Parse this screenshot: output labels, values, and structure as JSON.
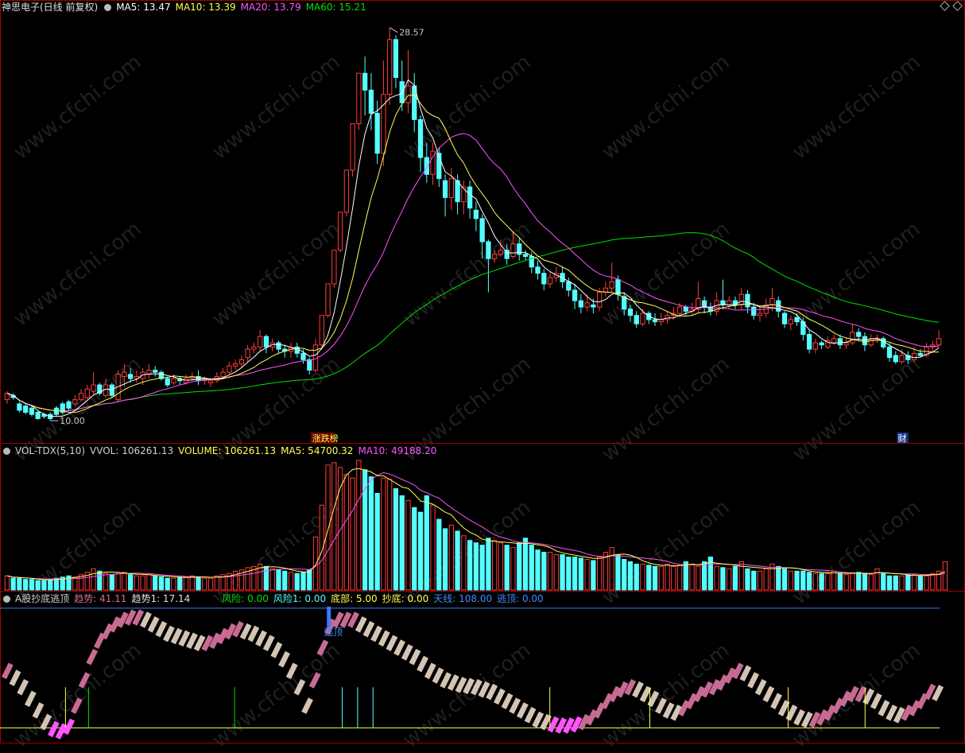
{
  "main_header": {
    "title": "神思电子(日线 前复权)",
    "ma5": "MA5: 13.47",
    "ma10": "MA10: 13.39",
    "ma20": "MA20: 13.79",
    "ma60": "MA60: 15.21",
    "high_label": "28.57",
    "low_label": "10.00",
    "marker_zdb": "涨跌榜",
    "marker_cai": "财"
  },
  "volume_header": {
    "name": "VOL-TDX(5,10)",
    "vvol": "VVOL: 106261.13",
    "volume": "VOLUME: 106261.13",
    "ma5": "MA5: 54700.32",
    "ma10": "MA10: 49188.20"
  },
  "indicator_header": {
    "name": "A股抄底逃顶",
    "trend": "趋势: 41.11",
    "trend1": "趋势1: 17.14",
    "risk": "风险: 0.00",
    "risk1": "风险1: 0.00",
    "bottom": "底部: 5.00",
    "buy_bottom": "抄底: 0.00",
    "sky_line": "天线: 108.00",
    "escape_top": "逃顶: 0.00",
    "escape_label": "逃顶"
  },
  "watermark": "www.cfchi.com",
  "colors": {
    "up": "#ff3c3c",
    "down": "#54ffff",
    "ma5": "#ffffff",
    "ma10": "#ffff54",
    "ma20": "#ff54ff",
    "ma60": "#00e000",
    "skyline": "#3c78ff",
    "baseline": "#ffff54",
    "trend_rise": "#c86a94",
    "trend_fall": "#d4c4b4",
    "risk": "#ff54ff"
  },
  "chart_data": {
    "type": "candlestick",
    "price_range": [
      10.0,
      28.57
    ],
    "high_point": 28.57,
    "low_point": 10.0,
    "ma_last": {
      "ma5": 13.47,
      "ma10": 13.39,
      "ma20": 13.79,
      "ma60": 15.21
    },
    "candles": [
      [
        10.9,
        11.2,
        10.7,
        11.3
      ],
      [
        11.1,
        11.0,
        10.9,
        11.2
      ],
      [
        10.7,
        10.4,
        10.3,
        10.8
      ],
      [
        10.6,
        10.3,
        10.2,
        10.7
      ],
      [
        10.5,
        10.2,
        10.1,
        10.6
      ],
      [
        10.3,
        10.0,
        9.95,
        10.4
      ],
      [
        10.2,
        10.1,
        10.0,
        10.3
      ],
      [
        10.2,
        10.0,
        9.9,
        10.3
      ],
      [
        10.5,
        10.2,
        10.1,
        10.6
      ],
      [
        10.7,
        10.3,
        10.2,
        10.8
      ],
      [
        10.8,
        10.5,
        10.4,
        10.9
      ],
      [
        10.7,
        10.9,
        10.6,
        11.1
      ],
      [
        10.9,
        11.2,
        10.8,
        11.4
      ],
      [
        11.0,
        11.4,
        10.9,
        11.6
      ],
      [
        11.3,
        11.6,
        11.1,
        12.2
      ],
      [
        11.6,
        11.2,
        11.1,
        11.7
      ],
      [
        11.1,
        11.6,
        11.0,
        11.9
      ],
      [
        11.6,
        11.1,
        11.0,
        11.7
      ],
      [
        10.9,
        12.1,
        10.8,
        12.3
      ],
      [
        12.0,
        12.2,
        11.5,
        12.6
      ],
      [
        12.1,
        11.9,
        11.7,
        12.4
      ],
      [
        11.9,
        12.0,
        11.7,
        12.3
      ],
      [
        11.9,
        12.2,
        11.6,
        12.4
      ],
      [
        12.1,
        12.3,
        11.9,
        12.6
      ],
      [
        12.3,
        12.2,
        12.0,
        12.5
      ],
      [
        12.2,
        11.9,
        11.8,
        12.3
      ],
      [
        11.9,
        11.6,
        11.5,
        12.0
      ],
      [
        11.7,
        11.9,
        11.6,
        12.1
      ],
      [
        11.9,
        11.8,
        11.6,
        12.0
      ],
      [
        11.7,
        11.9,
        11.6,
        12.1
      ],
      [
        11.9,
        12.0,
        11.8,
        12.2
      ],
      [
        12.0,
        11.8,
        11.6,
        12.3
      ],
      [
        11.8,
        11.9,
        11.6,
        12.0
      ],
      [
        11.7,
        11.8,
        11.5,
        11.9
      ],
      [
        11.8,
        12.0,
        11.7,
        12.2
      ],
      [
        12.0,
        12.2,
        11.9,
        12.4
      ],
      [
        12.2,
        12.5,
        12.1,
        12.7
      ],
      [
        12.5,
        12.6,
        12.3,
        12.8
      ],
      [
        12.6,
        12.8,
        12.4,
        13.0
      ],
      [
        12.9,
        13.3,
        12.7,
        13.5
      ],
      [
        13.3,
        13.4,
        13.1,
        13.6
      ],
      [
        13.4,
        13.9,
        13.2,
        14.2
      ],
      [
        13.9,
        13.4,
        13.1,
        14.0
      ],
      [
        13.4,
        13.6,
        13.2,
        13.8
      ],
      [
        13.6,
        13.3,
        13.1,
        13.7
      ],
      [
        13.3,
        13.2,
        12.9,
        13.5
      ],
      [
        13.2,
        13.4,
        12.9,
        13.6
      ],
      [
        13.4,
        13.1,
        12.9,
        13.6
      ],
      [
        13.1,
        12.8,
        12.6,
        13.3
      ],
      [
        12.8,
        12.3,
        12.1,
        12.9
      ],
      [
        12.3,
        13.5,
        12.2,
        13.8
      ],
      [
        13.5,
        14.9,
        13.4,
        14.9
      ],
      [
        14.9,
        16.4,
        14.8,
        16.4
      ],
      [
        16.4,
        18.0,
        16.2,
        18.0
      ],
      [
        18.0,
        19.8,
        17.9,
        19.8
      ],
      [
        19.8,
        21.8,
        19.6,
        21.8
      ],
      [
        21.8,
        24.0,
        21.5,
        24.0
      ],
      [
        24.0,
        26.4,
        23.7,
        26.4
      ],
      [
        26.4,
        25.6,
        24.4,
        27.2
      ],
      [
        25.6,
        24.5,
        23.7,
        26.4
      ],
      [
        24.5,
        22.6,
        22.1,
        25.1
      ],
      [
        22.6,
        25.4,
        22.0,
        27.0
      ],
      [
        25.4,
        28.0,
        24.9,
        28.57
      ],
      [
        28.0,
        26.2,
        25.7,
        28.2
      ],
      [
        26.0,
        25.0,
        24.6,
        27.0
      ],
      [
        25.0,
        25.8,
        24.5,
        27.5
      ],
      [
        25.8,
        24.2,
        23.6,
        26.4
      ],
      [
        24.2,
        22.4,
        21.7,
        24.4
      ],
      [
        22.4,
        21.6,
        21.2,
        23.1
      ],
      [
        21.6,
        22.7,
        21.1,
        23.1
      ],
      [
        22.6,
        21.4,
        21.0,
        22.9
      ],
      [
        21.3,
        20.5,
        19.6,
        21.6
      ],
      [
        20.5,
        21.4,
        19.9,
        21.9
      ],
      [
        21.3,
        20.3,
        19.7,
        21.6
      ],
      [
        20.3,
        21.0,
        19.7,
        21.3
      ],
      [
        21.0,
        20.0,
        19.5,
        21.3
      ],
      [
        19.9,
        19.5,
        18.9,
        20.3
      ],
      [
        19.5,
        18.4,
        17.6,
        19.7
      ],
      [
        18.4,
        17.6,
        16.0,
        18.5
      ],
      [
        17.6,
        17.8,
        17.4,
        18.0
      ],
      [
        17.8,
        18.0,
        17.7,
        18.5
      ],
      [
        18.0,
        17.6,
        17.3,
        18.3
      ],
      [
        17.7,
        18.3,
        17.6,
        18.9
      ],
      [
        18.3,
        17.8,
        17.5,
        18.6
      ],
      [
        17.8,
        17.7,
        17.5,
        18.0
      ],
      [
        17.7,
        17.2,
        16.9,
        17.9
      ],
      [
        17.2,
        16.9,
        16.6,
        17.5
      ],
      [
        16.9,
        16.4,
        16.1,
        17.1
      ],
      [
        16.4,
        16.7,
        16.2,
        17.0
      ],
      [
        16.7,
        16.9,
        16.5,
        17.2
      ],
      [
        16.9,
        16.5,
        16.2,
        17.2
      ],
      [
        16.5,
        16.1,
        15.8,
        16.7
      ],
      [
        16.1,
        15.6,
        15.2,
        16.4
      ],
      [
        15.6,
        15.3,
        15.0,
        15.9
      ],
      [
        15.3,
        15.5,
        15.1,
        15.9
      ],
      [
        15.4,
        15.3,
        15.0,
        15.7
      ],
      [
        15.3,
        16.0,
        15.1,
        16.2
      ],
      [
        16.0,
        16.2,
        15.8,
        16.5
      ],
      [
        16.2,
        16.5,
        16.0,
        17.4
      ],
      [
        16.6,
        15.9,
        15.6,
        16.8
      ],
      [
        15.8,
        15.2,
        14.9,
        16.0
      ],
      [
        15.2,
        14.9,
        14.6,
        15.4
      ],
      [
        14.9,
        14.5,
        14.3,
        15.1
      ],
      [
        14.5,
        15.0,
        14.4,
        15.2
      ],
      [
        15.0,
        14.7,
        14.5,
        15.1
      ],
      [
        14.7,
        14.6,
        14.4,
        15.0
      ],
      [
        14.6,
        14.7,
        14.4,
        15.0
      ],
      [
        14.7,
        14.9,
        14.5,
        15.1
      ],
      [
        14.9,
        15.0,
        14.7,
        15.3
      ],
      [
        15.0,
        15.3,
        14.8,
        15.5
      ],
      [
        15.3,
        15.1,
        14.9,
        15.4
      ],
      [
        15.1,
        15.2,
        14.9,
        15.5
      ],
      [
        15.2,
        15.7,
        15.0,
        16.5
      ],
      [
        15.6,
        15.3,
        15.0,
        15.8
      ],
      [
        15.3,
        15.1,
        14.9,
        15.5
      ],
      [
        15.1,
        15.6,
        14.9,
        16.0
      ],
      [
        15.6,
        15.4,
        15.2,
        16.6
      ],
      [
        15.4,
        15.6,
        15.2,
        15.8
      ],
      [
        15.6,
        15.4,
        15.2,
        15.8
      ],
      [
        15.4,
        15.9,
        15.2,
        16.2
      ],
      [
        15.9,
        15.3,
        15.0,
        16.1
      ],
      [
        15.3,
        14.9,
        14.7,
        15.5
      ],
      [
        14.9,
        15.0,
        14.6,
        15.3
      ],
      [
        15.0,
        15.4,
        14.8,
        15.7
      ],
      [
        15.4,
        15.7,
        15.1,
        16.2
      ],
      [
        15.6,
        15.1,
        14.8,
        15.8
      ],
      [
        15.0,
        14.5,
        14.3,
        15.1
      ],
      [
        14.5,
        14.7,
        14.2,
        14.9
      ],
      [
        14.8,
        14.6,
        14.4,
        15.0
      ],
      [
        14.6,
        14.0,
        13.7,
        14.8
      ],
      [
        14.0,
        13.3,
        13.1,
        14.2
      ],
      [
        13.3,
        13.6,
        13.1,
        13.8
      ],
      [
        13.6,
        13.5,
        13.3,
        13.7
      ],
      [
        13.4,
        13.7,
        13.3,
        13.9
      ],
      [
        13.6,
        13.8,
        13.5,
        14.0
      ],
      [
        13.8,
        13.5,
        13.3,
        14.0
      ],
      [
        13.5,
        13.6,
        13.3,
        13.8
      ],
      [
        13.6,
        14.1,
        13.5,
        14.5
      ],
      [
        14.1,
        13.9,
        13.7,
        14.3
      ],
      [
        13.9,
        13.5,
        13.2,
        14.1
      ],
      [
        13.5,
        13.8,
        13.4,
        14.0
      ],
      [
        13.8,
        13.8,
        13.6,
        14.0
      ],
      [
        13.8,
        13.4,
        13.3,
        13.9
      ],
      [
        13.4,
        12.9,
        12.7,
        13.6
      ],
      [
        13.0,
        12.7,
        12.6,
        13.2
      ],
      [
        12.7,
        13.0,
        12.6,
        13.3
      ],
      [
        13.0,
        12.8,
        12.6,
        13.2
      ],
      [
        12.8,
        13.1,
        12.7,
        13.4
      ],
      [
        13.1,
        13.0,
        12.9,
        13.3
      ],
      [
        13.0,
        13.4,
        12.9,
        13.6
      ],
      [
        13.4,
        13.5,
        13.2,
        13.7
      ],
      [
        13.5,
        13.8,
        13.4,
        14.2
      ]
    ],
    "volume": [
      12,
      10,
      10,
      9,
      9,
      8,
      8,
      9,
      10,
      11,
      12,
      11,
      13,
      15,
      18,
      16,
      14,
      13,
      14,
      15,
      13,
      12,
      12,
      13,
      12,
      11,
      10,
      10,
      11,
      11,
      12,
      11,
      10,
      10,
      12,
      13,
      14,
      16,
      17,
      19,
      20,
      22,
      20,
      18,
      17,
      16,
      15,
      14,
      15,
      17,
      45,
      72,
      106,
      108,
      104,
      98,
      95,
      110,
      102,
      96,
      82,
      95,
      94,
      86,
      80,
      76,
      70,
      66,
      80,
      72,
      60,
      52,
      55,
      50,
      46,
      42,
      40,
      38,
      44,
      42,
      40,
      38,
      36,
      40,
      44,
      38,
      34,
      32,
      32,
      30,
      30,
      28,
      28,
      27,
      26,
      25,
      28,
      32,
      36,
      30,
      26,
      24,
      22,
      22,
      21,
      20,
      20,
      22,
      20,
      21,
      24,
      22,
      20,
      24,
      28,
      20,
      19,
      18,
      20,
      24,
      18,
      16,
      16,
      18,
      22,
      20,
      18,
      16,
      16,
      16,
      15,
      14,
      14,
      14,
      16,
      14,
      13,
      14,
      15,
      14,
      13,
      18,
      14,
      12,
      12,
      12,
      13,
      13,
      12,
      12,
      14,
      16,
      24
    ],
    "trend": [
      60,
      54,
      46,
      36,
      26,
      16,
      10,
      8,
      12,
      30,
      52,
      72,
      86,
      94,
      100,
      104,
      106,
      106,
      104,
      100,
      96,
      92,
      90,
      88,
      86,
      84,
      84,
      86,
      90,
      94,
      96,
      94,
      92,
      88,
      84,
      78,
      70,
      60,
      46,
      30,
      52,
      80,
      98,
      104,
      104,
      104,
      100,
      96,
      92,
      88,
      84,
      80,
      76,
      72,
      66,
      60,
      56,
      52,
      50,
      48,
      47,
      46,
      44,
      42,
      38,
      34,
      30,
      26,
      22,
      18,
      16,
      14,
      13,
      13,
      14,
      16,
      20,
      26,
      34,
      40,
      44,
      46,
      44,
      40,
      36,
      30,
      26,
      24,
      28,
      34,
      40,
      44,
      46,
      50,
      56,
      60,
      58,
      52,
      46,
      40,
      34,
      28,
      24,
      20,
      18,
      18,
      20,
      24,
      30,
      36,
      40,
      40,
      38,
      34,
      28,
      24,
      22,
      24,
      28,
      34,
      42,
      41
    ],
    "indicator_levels": {
      "trend": 41.11,
      "trend1": 17.14,
      "bottom": 5.0,
      "sky_line": 108.0,
      "escape_top": 0.0,
      "risk": 0.0
    }
  }
}
